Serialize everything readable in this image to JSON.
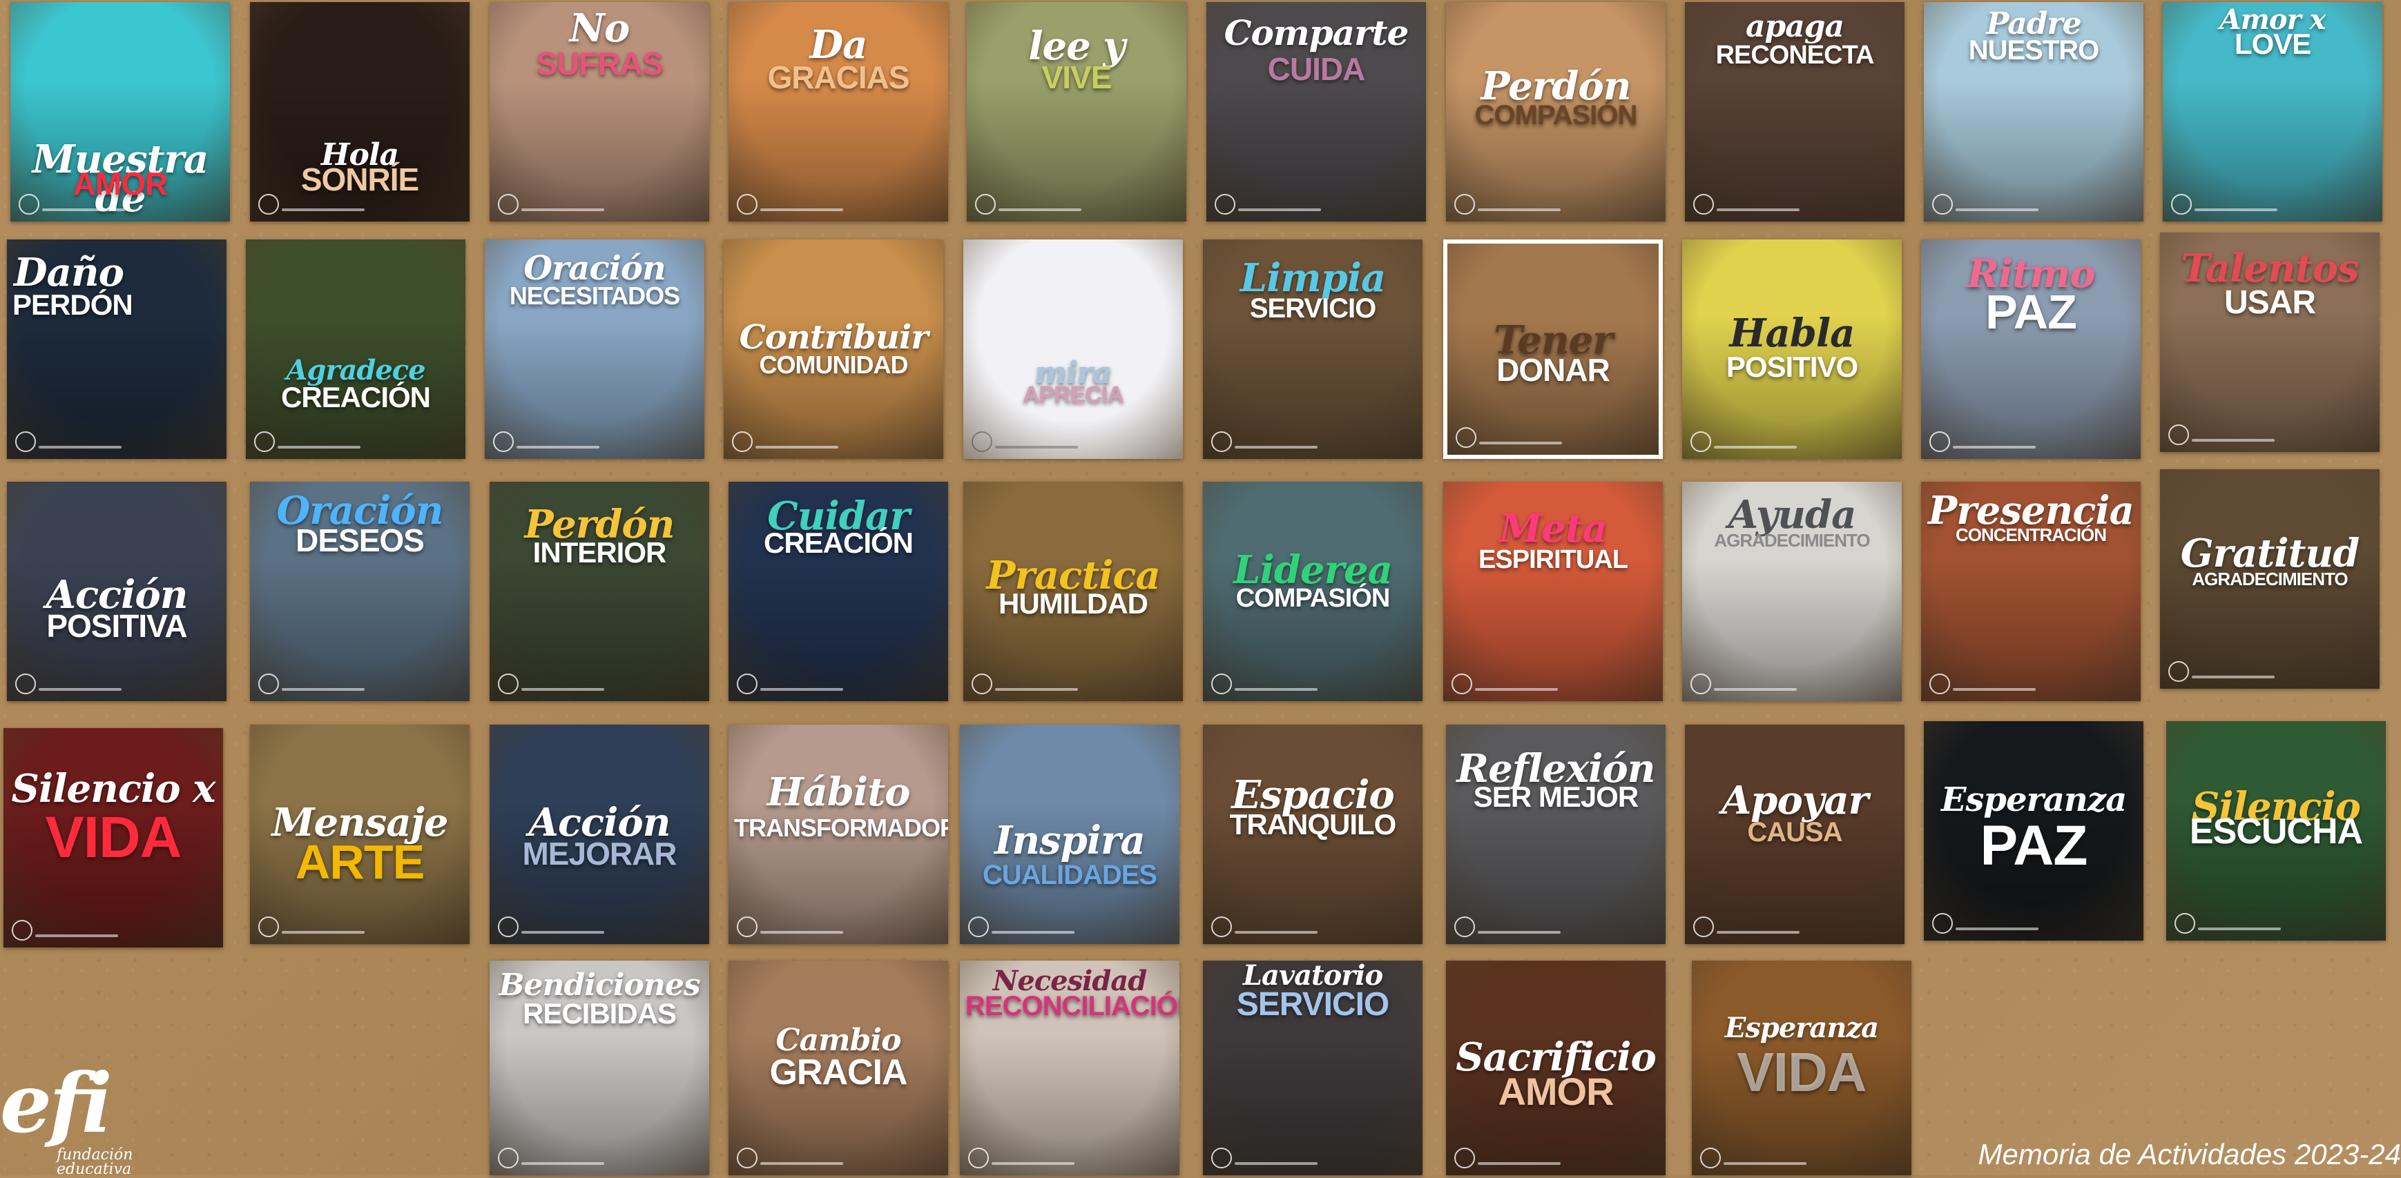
{
  "footer": {
    "text": "Memoria de Actividades 2023-24"
  },
  "logo": {
    "mark": "efi",
    "line1": "fundación",
    "line2": "educativa"
  },
  "tiles": [
    {
      "script": "Muestra de",
      "block": "AMOR",
      "bg": "#3cc6cf"
    },
    {
      "script": "Hola",
      "block": "SONRÍE",
      "bg": "#2a1d17"
    },
    {
      "script": "No",
      "block": "SUFRAS",
      "bg": "#b9927b"
    },
    {
      "script": "Da",
      "block": "GRACIAS",
      "bg": "#d68a4a"
    },
    {
      "script": "lee y",
      "block": "VIVE",
      "bg": "#9aa06b"
    },
    {
      "script": "Comparte",
      "block": "CUIDA",
      "bg": "#4d4a4e"
    },
    {
      "script": "Perdón",
      "block": "COMPASIÓN",
      "bg": "#c69566"
    },
    {
      "script": "apaga",
      "block": "RECONECTA",
      "bg": "#594236"
    },
    {
      "script": "Padre",
      "block": "NUESTRO",
      "bg": "#a8cadb"
    },
    {
      "script": "Amor x",
      "block": "LOVE",
      "bg": "#46b9c8"
    },
    {
      "script": "Daño",
      "block": "PERDÓN",
      "bg": "#1d2b3c"
    },
    {
      "script": "Agradece",
      "block": "CREACIÓN",
      "bg": "#3e4f2b"
    },
    {
      "script": "Oración",
      "block": "NECESITADOS",
      "bg": "#89a7c5"
    },
    {
      "script": "Contribuir",
      "block": "COMUNIDAD",
      "bg": "#c98f4c"
    },
    {
      "script": "mira",
      "block": "APRECIA",
      "bg": "#f2f2f6"
    },
    {
      "script": "Limpia",
      "block": "SERVICIO",
      "bg": "#6c5338"
    },
    {
      "script": "Tener",
      "block": "DONAR",
      "bg": "#a4784e"
    },
    {
      "script": "Habla",
      "block": "POSITIVO",
      "bg": "#e0d24d"
    },
    {
      "script": "Ritmo",
      "block": "PAZ",
      "bg": "#8b9bb0"
    },
    {
      "script": "Talentos",
      "block": "USAR",
      "bg": "#8c6f56"
    },
    {
      "script": "Acción",
      "block": "POSITIVA",
      "bg": "#3a4252"
    },
    {
      "script": "Oración",
      "block": "DESEOS",
      "bg": "#5b7184"
    },
    {
      "script": "Perdón",
      "block": "INTERIOR",
      "bg": "#3b4833"
    },
    {
      "script": "Cuidar",
      "block": "CREACIÓN",
      "bg": "#22324e"
    },
    {
      "script": "Practica",
      "block": "HUMILDAD",
      "bg": "#8a6b3d"
    },
    {
      "script": "Liderea",
      "block": "COMPASIÓN",
      "bg": "#4f6c72"
    },
    {
      "script": "Meta",
      "block": "ESPIRITUAL",
      "bg": "#d45a3a"
    },
    {
      "script": "Ayuda",
      "block": "AGRADECIMIENTO",
      "bg": "#d7d5d0"
    },
    {
      "script": "Presencia",
      "block": "CONCENTRACIÓN",
      "bg": "#a25232"
    },
    {
      "script": "Gratitud",
      "block": "AGRADECIMIENTO",
      "bg": "#5f4b33"
    },
    {
      "script": "Silencio x",
      "block": "VIDA",
      "bg": "#6b1c1b"
    },
    {
      "script": "Mensaje",
      "block": "ARTE",
      "bg": "#8c7347"
    },
    {
      "script": "Acción",
      "block": "MEJORAR",
      "bg": "#2f3f57"
    },
    {
      "script": "Hábito",
      "block": "TRANSFORMADOR",
      "bg": "#b59a8d"
    },
    {
      "script": "Inspira",
      "block": "CUALIDADES",
      "bg": "#6e8aa8"
    },
    {
      "script": "Espacio",
      "block": "TRANQUILO",
      "bg": "#6b4d35"
    },
    {
      "script": "Reflexión",
      "block": "SER MEJOR",
      "bg": "#5a5a5c"
    },
    {
      "script": "Apoyar",
      "block": "CAUSA",
      "bg": "#5a3c2a"
    },
    {
      "script": "Esperanza",
      "block": "PAZ",
      "bg": "#16191c"
    },
    {
      "script": "Silencio",
      "block": "ESCUCHA",
      "bg": "#2e5a34"
    },
    {
      "script": "Bendiciones",
      "block": "RECIBIDAS",
      "bg": "#c9c7c6"
    },
    {
      "script": "Cambio",
      "block": "GRACIA",
      "bg": "#a47b5b"
    },
    {
      "script": "Necesidad",
      "block": "RECONCILIACIÓN",
      "bg": "#cfc3b9"
    },
    {
      "script": "Lavatorio",
      "block": "SERVICIO",
      "bg": "#3e3a3b"
    },
    {
      "script": "Sacrificio",
      "block": "AMOR",
      "bg": "#5b3220"
    },
    {
      "script": "Esperanza",
      "block": "VIDA",
      "bg": "#8b5a2a"
    }
  ]
}
